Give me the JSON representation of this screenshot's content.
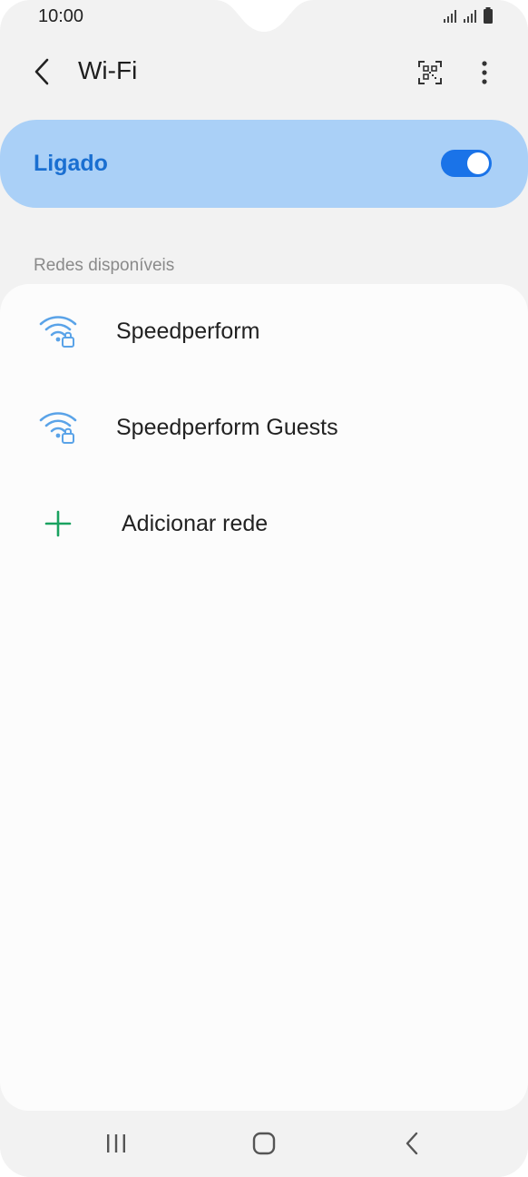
{
  "status_bar": {
    "time": "10:00",
    "icons": [
      "signal-icon",
      "signal-icon",
      "battery-icon"
    ]
  },
  "header": {
    "title": "Wi-Fi",
    "back_icon": "chevron-left-icon",
    "qr_icon": "qr-code-icon",
    "more_icon": "more-vertical-icon"
  },
  "wifi_toggle": {
    "label": "Ligado",
    "state": "on",
    "accent_color": "#1a73e8",
    "card_color": "#aad0f7"
  },
  "networks": {
    "section_title": "Redes disponíveis",
    "items": [
      {
        "name": "Speedperform",
        "icon": "wifi-lock-icon"
      },
      {
        "name": "Speedperform Guests",
        "icon": "wifi-lock-icon"
      }
    ],
    "add_network": {
      "label": "Adicionar rede",
      "icon": "plus-icon",
      "icon_color": "#1aa260"
    }
  },
  "nav_bar": {
    "icons": [
      "recents-icon",
      "home-icon",
      "back-icon"
    ]
  }
}
